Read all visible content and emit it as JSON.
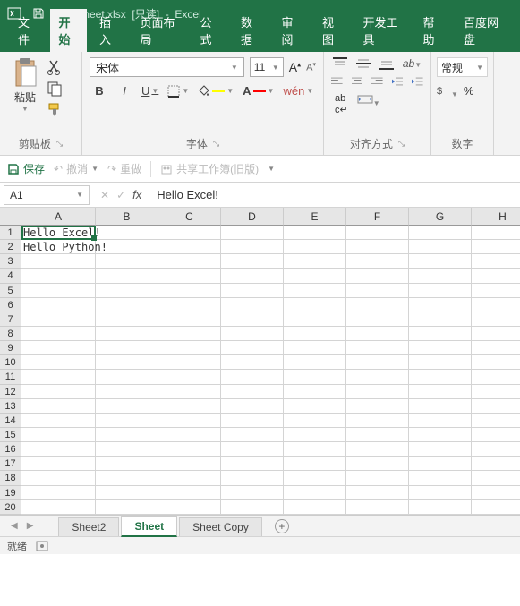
{
  "titlebar": {
    "filename": "worksheet.xlsx",
    "readonly": "[只读]",
    "app": "Excel"
  },
  "menu": [
    "文件",
    "开始",
    "插入",
    "页面布局",
    "公式",
    "数据",
    "审阅",
    "视图",
    "开发工具",
    "帮助",
    "百度网盘"
  ],
  "menu_active_index": 1,
  "ribbon": {
    "clipboard": {
      "paste": "粘贴",
      "label": "剪贴板"
    },
    "font": {
      "name": "宋体",
      "size": "11",
      "label": "字体",
      "wen": "wén"
    },
    "align": {
      "label": "对齐方式"
    },
    "number": {
      "format": "常规",
      "label": "数字"
    }
  },
  "qat": {
    "save": "保存",
    "undo": "撤消",
    "redo": "重做",
    "share": "共享工作簿(旧版)"
  },
  "formula": {
    "namebox": "A1",
    "value": "Hello Excel!"
  },
  "columns": [
    "A",
    "B",
    "C",
    "D",
    "E",
    "F",
    "G",
    "H"
  ],
  "rows": [
    "1",
    "2",
    "3",
    "4",
    "5",
    "6",
    "7",
    "8",
    "9",
    "10",
    "11",
    "12",
    "13",
    "14",
    "15",
    "16",
    "17",
    "18",
    "19",
    "20"
  ],
  "cells": {
    "A1": "Hello Excel!",
    "A2": "Hello Python!"
  },
  "sheets": [
    "Sheet2",
    "Sheet",
    "Sheet Copy"
  ],
  "sheets_active_index": 1,
  "status": {
    "ready": "就绪"
  }
}
